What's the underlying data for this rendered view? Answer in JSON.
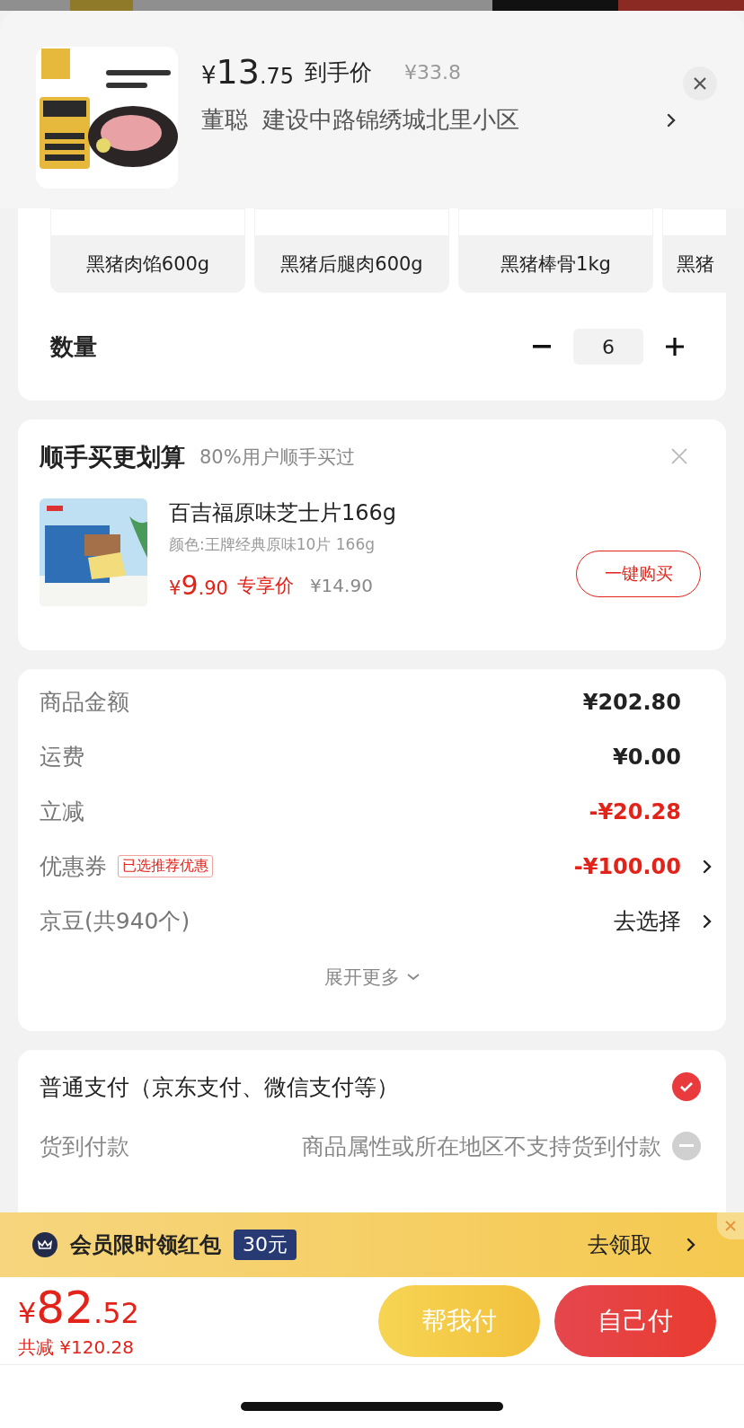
{
  "header": {
    "price_symbol": "¥",
    "price_integer": "13",
    "price_decimal": ".75",
    "price_label": "到手价",
    "original_price": "¥33.8",
    "recipient": "董聪",
    "address": "建设中路锦绣城北里小区"
  },
  "variants": [
    {
      "label": "黑猪肉馅600g"
    },
    {
      "label": "黑猪后腿肉600g"
    },
    {
      "label": "黑猪棒骨1kg"
    },
    {
      "label": "黑猪"
    }
  ],
  "quantity": {
    "label": "数量",
    "value": "6"
  },
  "addon": {
    "title": "顺手买更划算",
    "subtitle": "80%用户顺手买过",
    "product": {
      "name": "百吉福原味芝士片166g",
      "spec": "颜色:王牌经典原味10片 166g",
      "price_symbol": "¥",
      "price_integer": "9",
      "price_decimal": ".90",
      "price_label": "专享价",
      "original_price": "¥14.90",
      "button": "一键购买"
    }
  },
  "summary": {
    "rows": [
      {
        "label": "商品金额",
        "value": "¥202.80",
        "kind": "amount",
        "arrow": false
      },
      {
        "label": "运费",
        "value": "¥0.00",
        "kind": "amount",
        "arrow": false
      },
      {
        "label": "立减",
        "value": "-¥20.28",
        "kind": "discount",
        "arrow": false
      },
      {
        "label": "优惠券",
        "tag": "已选推荐优惠",
        "value": "-¥100.00",
        "kind": "discount",
        "arrow": true
      },
      {
        "label": "京豆(共940个)",
        "value": "去选择",
        "kind": "action",
        "arrow": true
      }
    ],
    "expand": "展开更多"
  },
  "payment": {
    "options": [
      {
        "label": "普通支付（京东支付、微信支付等）",
        "selected": true,
        "disabled": false
      },
      {
        "label": "货到付款",
        "note": "商品属性或所在地区不支持货到付款",
        "selected": false,
        "disabled": true
      }
    ]
  },
  "banner": {
    "text": "会员限时领红包",
    "badge": "30元",
    "action": "去领取"
  },
  "footer": {
    "price_symbol": "¥",
    "price_integer": "82",
    "price_decimal": ".52",
    "saving": "共减 ¥120.28",
    "buttons": [
      {
        "label": "帮我付",
        "kind": "secondary"
      },
      {
        "label": "自己付",
        "kind": "primary"
      }
    ]
  }
}
